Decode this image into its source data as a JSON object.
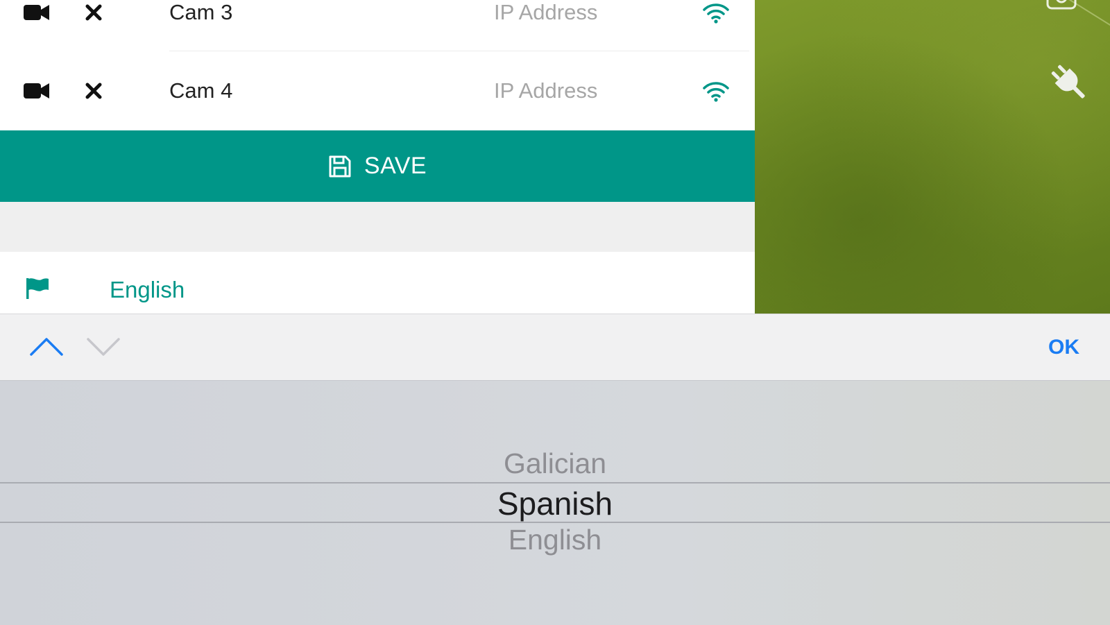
{
  "cameras": [
    {
      "name": "Cam 3",
      "ip_placeholder": "IP Address",
      "icon": "video-camera-icon",
      "delete_icon": "close-icon",
      "status_icon": "wifi-icon"
    },
    {
      "name": "Cam 4",
      "ip_placeholder": "IP Address",
      "icon": "video-camera-icon",
      "delete_icon": "close-icon",
      "status_icon": "wifi-icon"
    }
  ],
  "save_button": {
    "label": "SAVE",
    "icon": "floppy-disk-icon"
  },
  "language": {
    "icon": "flag-icon",
    "value": "English"
  },
  "keyboard_toolbar": {
    "ok_label": "OK",
    "up_icon": "chevron-up-icon",
    "down_icon": "chevron-down-icon"
  },
  "picker": {
    "items": [
      "Galician",
      "Spanish",
      "English"
    ],
    "selected": "Spanish"
  },
  "colors": {
    "accent": "#009688",
    "ios_blue": "#1a7cf3",
    "text_dark": "#222222",
    "placeholder": "#a6a6a6"
  }
}
